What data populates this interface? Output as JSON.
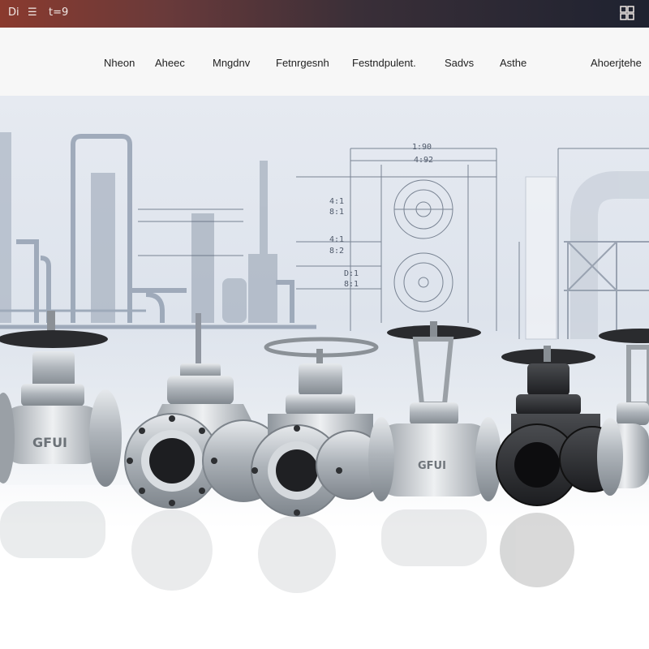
{
  "topbar": {
    "left_items": [
      "Di",
      "☰",
      "t=9"
    ],
    "right_icon": "grid-icon"
  },
  "nav": {
    "items": [
      "Nheon",
      "Aheec",
      "Mngdnv",
      "Fetnrgesnh",
      "Festndpulent.",
      "Sadvs",
      "Asthe",
      "Ahoerjtehe"
    ]
  },
  "schematic": {
    "dims": [
      "1:90",
      "4:92"
    ],
    "labels_left": [
      "4:1",
      "8:1",
      "4:1",
      "8:2",
      "D:1",
      "8:1"
    ]
  },
  "valves": {
    "body_markings": [
      "GFUI",
      "GFUI",
      "GFUI"
    ]
  },
  "colors": {
    "topbar_start": "#8a3a2e",
    "topbar_end": "#1e2230",
    "steel": "#b9bec4",
    "dark_valve": "#2a2b2e"
  }
}
